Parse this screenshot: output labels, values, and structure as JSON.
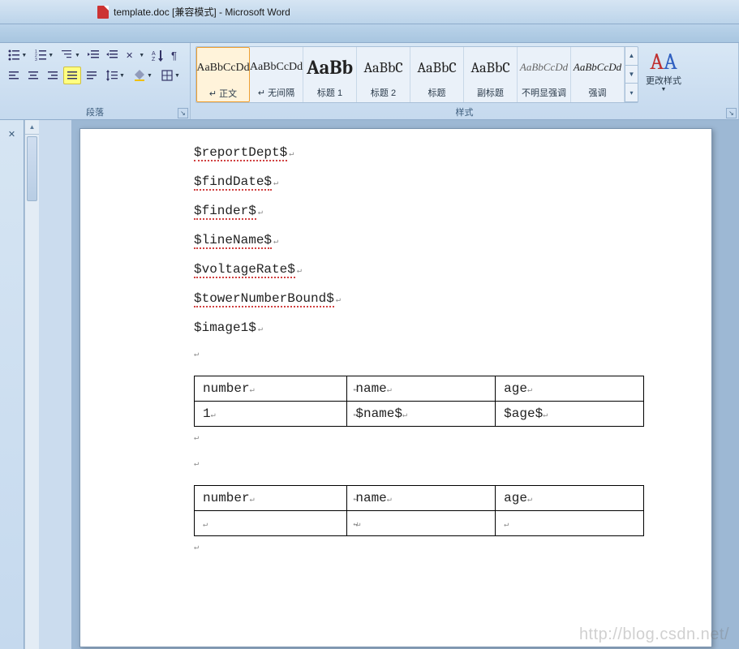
{
  "window": {
    "title": "template.doc [兼容模式] - Microsoft Word"
  },
  "ribbon": {
    "paragraph_label": "段落",
    "styles_label": "样式",
    "change_styles_label": "更改样式",
    "styles": [
      {
        "preview": "AaBbCcDd",
        "label": "↵ 正文"
      },
      {
        "preview": "AaBbCcDd",
        "label": "↵ 无间隔"
      },
      {
        "preview": "AaBb",
        "label": "标题 1"
      },
      {
        "preview": "AaBbC",
        "label": "标题 2"
      },
      {
        "preview": "AaBbC",
        "label": "标题"
      },
      {
        "preview": "AaBbC",
        "label": "副标题"
      },
      {
        "preview": "AaBbCcDd",
        "label": "不明显强调"
      },
      {
        "preview": "AaBbCcDd",
        "label": "强调"
      }
    ]
  },
  "document": {
    "lines": [
      "$reportDept$",
      "$findDate$",
      "$finder$",
      "$lineName$",
      "$voltageRate$",
      "$towerNumberBound$",
      "$image1$"
    ],
    "tables": [
      {
        "headers": [
          "number",
          "name",
          "age"
        ],
        "rows": [
          [
            "1",
            "$name$",
            "$age$"
          ]
        ]
      },
      {
        "headers": [
          "number",
          "name",
          "age"
        ],
        "rows": [
          [
            "",
            "",
            ""
          ]
        ]
      }
    ]
  },
  "watermark": "http://blog.csdn.net/"
}
